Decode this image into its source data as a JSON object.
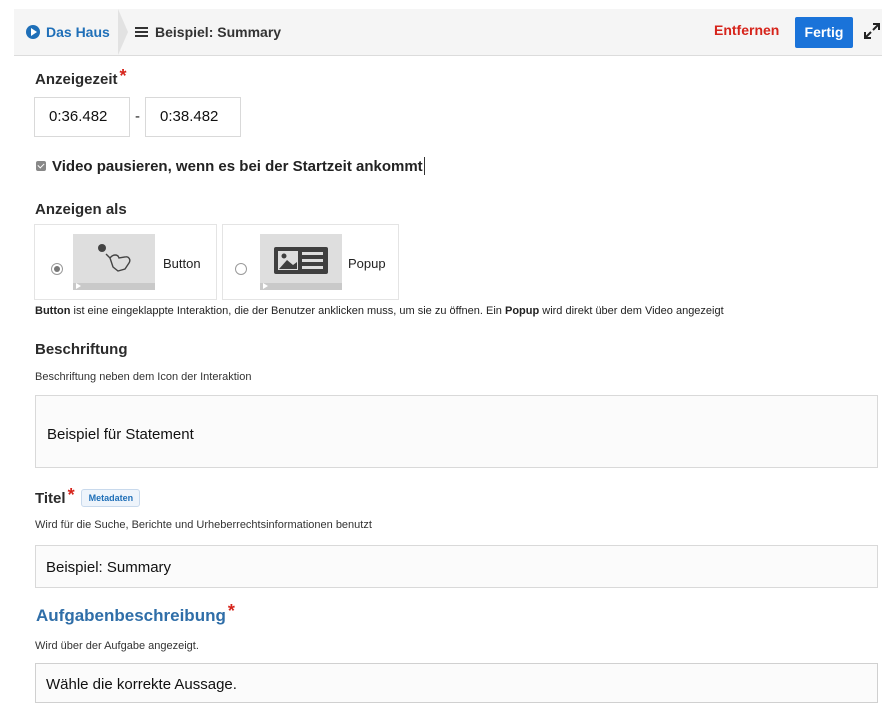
{
  "header": {
    "home_label": "Das Haus",
    "current_label": "Beispiel: Summary",
    "remove_label": "Entfernen",
    "done_label": "Fertig"
  },
  "display_time": {
    "label": "Anzeigezeit",
    "required_mark": "*",
    "start": "0:36.482",
    "separator": "-",
    "end": "0:38.482"
  },
  "pause_video": {
    "label": "Video pausieren, wenn es bei der Startzeit ankommt",
    "checked": true
  },
  "display_as": {
    "label": "Anzeigen als",
    "options": [
      {
        "label": "Button",
        "selected": true,
        "icon": "button-hand-icon"
      },
      {
        "label": "Popup",
        "selected": false,
        "icon": "popup-image-text-icon"
      }
    ],
    "help_bold_1": "Button",
    "help_text_1": " ist eine eingeklappte Interaktion, die der Benutzer anklicken muss, um sie zu öffnen. Ein ",
    "help_bold_2": "Popup",
    "help_text_2": " wird direkt über dem Video angezeigt"
  },
  "label_field": {
    "label": "Beschriftung",
    "description": "Beschriftung neben dem Icon der Interaktion",
    "value": "Beispiel für Statement"
  },
  "title_field": {
    "label": "Titel",
    "required_mark": "*",
    "badge": "Metadaten",
    "description": "Wird für die Suche, Berichte und Urheberrechtsinformationen benutzt",
    "value": "Beispiel: Summary"
  },
  "task_description": {
    "label": "Aufgabenbeschreibung",
    "required_mark": "*",
    "description": "Wird über der Aufgabe angezeigt.",
    "value": "Wähle die korrekte Aussage."
  },
  "colors": {
    "accent": "#1a73d9",
    "remove": "#d6241b",
    "required": "#d6241b",
    "section_link": "#2f6ea8"
  }
}
